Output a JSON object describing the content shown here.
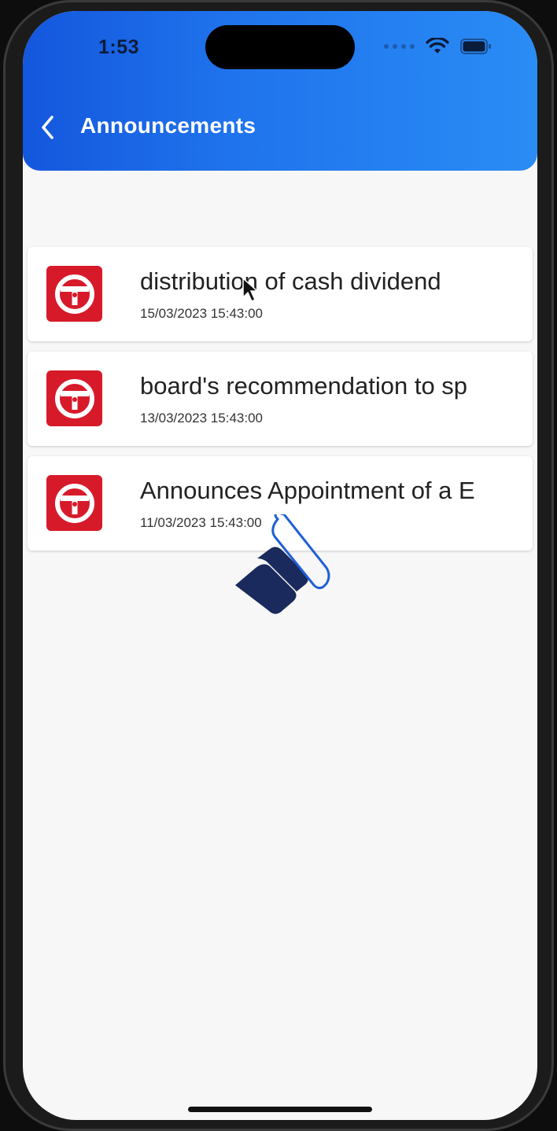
{
  "status_bar": {
    "time": "1:53"
  },
  "header": {
    "title": "Announcements",
    "back_icon": "chevron-left-icon"
  },
  "colors": {
    "header_start": "#1457dd",
    "header_end": "#2a8cf5",
    "logo_red": "#d71a2a",
    "loader_navy": "#1b2a5c",
    "loader_outline": "#1f5fd6"
  },
  "announcements": [
    {
      "title": "distribution of cash dividend",
      "date": "15/03/2023 15:43:00"
    },
    {
      "title": "board's recommendation to sp",
      "date": "13/03/2023 15:43:00"
    },
    {
      "title": "Announces Appointment of a E",
      "date": "11/03/2023 15:43:00"
    }
  ]
}
